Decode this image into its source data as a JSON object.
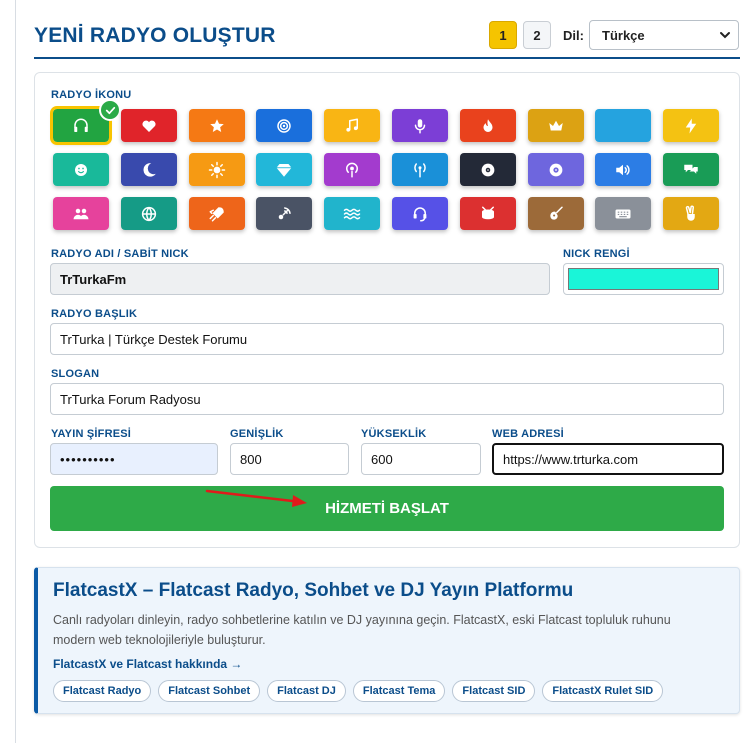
{
  "header": {
    "title": "YENİ RADYO OLUŞTUR",
    "pages": [
      "1",
      "2"
    ],
    "active_page": "1",
    "lang_label": "Dil:",
    "lang_value": "Türkçe"
  },
  "form": {
    "icon_label": "RADYO İKONU",
    "icons": [
      {
        "name": "headphones-icon",
        "color": "#27a244",
        "selected": true
      },
      {
        "name": "heart-icon",
        "color": "#d9262c"
      },
      {
        "name": "star-icon",
        "color": "#f07a1a"
      },
      {
        "name": "target-icon",
        "color": "#1e6fd6"
      },
      {
        "name": "music-note-icon",
        "color": "#f6b51c"
      },
      {
        "name": "microphone-icon",
        "color": "#7a3fd0"
      },
      {
        "name": "fire-icon",
        "color": "#e34420"
      },
      {
        "name": "crown-icon",
        "color": "#d9a21a"
      },
      {
        "name": "blank-icon",
        "color": "#2aa2db"
      },
      {
        "name": "lightning-icon",
        "color": "#f2c21a"
      },
      {
        "name": "smiley-icon",
        "color": "#1fb79a"
      },
      {
        "name": "moon-icon",
        "color": "#3a4aa8"
      },
      {
        "name": "sun-icon",
        "color": "#f29a1a"
      },
      {
        "name": "diamond-icon",
        "color": "#28b6d6"
      },
      {
        "name": "podcast-icon",
        "color": "#a03dc9"
      },
      {
        "name": "antenna-icon",
        "color": "#1f8fd4"
      },
      {
        "name": "disc-icon",
        "color": "#232936"
      },
      {
        "name": "vinyl-icon",
        "color": "#6e66d9"
      },
      {
        "name": "volume-icon",
        "color": "#2f7de0"
      },
      {
        "name": "chat-icon",
        "color": "#1e9a58"
      },
      {
        "name": "users-icon",
        "color": "#e0449a"
      },
      {
        "name": "globe-icon",
        "color": "#1a9a86"
      },
      {
        "name": "rocket-icon",
        "color": "#e9661f"
      },
      {
        "name": "satellite-icon",
        "color": "#4a5364"
      },
      {
        "name": "waves-icon",
        "color": "#27b3c9"
      },
      {
        "name": "headset-icon",
        "color": "#5652e0"
      },
      {
        "name": "drum-icon",
        "color": "#d63232"
      },
      {
        "name": "guitar-icon",
        "color": "#9a6a3c"
      },
      {
        "name": "keyboard-icon",
        "color": "#8a9099"
      },
      {
        "name": "peace-hand-icon",
        "color": "#e0a81a"
      }
    ],
    "name_label": "RADYO ADI / SABİT NICK",
    "name_value": "TrTurkaFm",
    "nick_color_label": "NICK RENGİ",
    "nick_color": "#1af5d8",
    "title_label": "RADYO BAŞLIK",
    "title_value": "TrTurka | Türkçe Destek Forumu",
    "slogan_label": "SLOGAN",
    "slogan_value": "TrTurka Forum Radyosu",
    "password_label": "YAYIN ŞİFRESİ",
    "password_value": "••••••••••",
    "width_label": "GENİŞLİK",
    "width_value": "800",
    "height_label": "YÜKSEKLİK",
    "height_value": "600",
    "web_label": "WEB ADRESİ",
    "web_value": "https://www.trturka.com",
    "submit_label": "HİZMETİ BAŞLAT"
  },
  "info": {
    "title": "FlatcastX – Flatcast Radyo, Sohbet ve DJ Yayın Platformu",
    "description": "Canlı radyoları dinleyin, radyo sohbetlerine katılın ve DJ yayınına geçin. FlatcastX, eski Flatcast topluluk ruhunu modern web teknolojileriyle buluşturur.",
    "link": "FlatcastX ve Flatcast hakkında →",
    "tags": [
      "Flatcast Radyo",
      "Flatcast Sohbet",
      "Flatcast DJ",
      "Flatcast Tema",
      "Flatcast SID",
      "FlatcastX Rulet SID"
    ]
  },
  "colors": {
    "primary": "#0b4d8a",
    "accent": "#f5c400",
    "success": "#2eaa48"
  }
}
